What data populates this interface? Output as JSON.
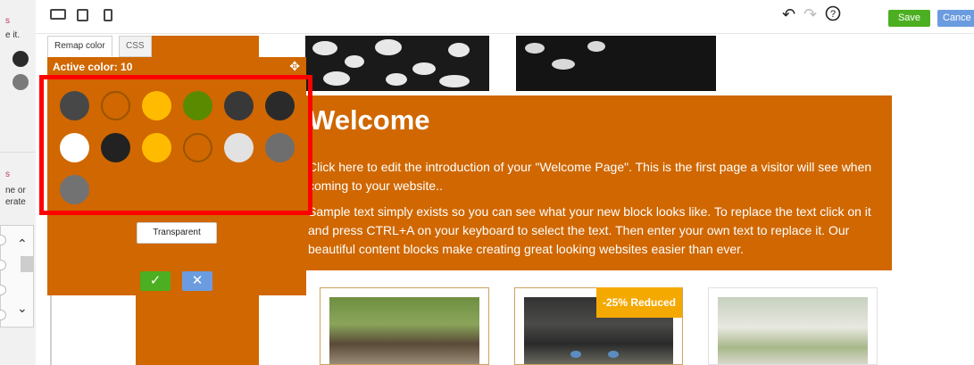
{
  "left_panel": {
    "top_text_1": "s",
    "top_text_2": "e it.",
    "dot_colors": [
      "#2b2b2b",
      "#7a7a7a"
    ],
    "mid_text_1": "s",
    "mid_text_2": "ne or",
    "mid_text_3": "erate"
  },
  "toolbar": {
    "save_label": "Save",
    "cancel_label": "Cance",
    "undo_icon": "↶",
    "redo_icon": "↷",
    "help_icon": "?"
  },
  "color_panel": {
    "tabs": [
      "Remap color",
      "CSS"
    ],
    "title": "Active color: 10",
    "swatches": [
      {
        "color": "#474747",
        "hollow": false
      },
      {
        "color": "#c86a00",
        "hollow": true
      },
      {
        "color": "#ffbb00",
        "hollow": false
      },
      {
        "color": "#5a8a00",
        "hollow": false
      },
      {
        "color": "#383838",
        "hollow": false
      },
      {
        "color": "#2a2a2a",
        "hollow": false
      },
      {
        "color": "#ffffff",
        "hollow": false
      },
      {
        "color": "#222222",
        "hollow": false
      },
      {
        "color": "#ffbb00",
        "hollow": false
      },
      {
        "color": "#c86a00",
        "hollow": true
      },
      {
        "color": "#e2e2e2",
        "hollow": false
      },
      {
        "color": "#6e6e6e",
        "hollow": false
      },
      {
        "color": "#727272",
        "hollow": false
      }
    ],
    "transparent_label": "Transparent",
    "ok_icon": "✓",
    "close_icon": "✕"
  },
  "page": {
    "welcome_title": "Welcome",
    "intro_text": "Click here to edit the introduction of your \"Welcome Page\". This is the first page a visitor will see when coming to your website..",
    "sample_text": "Sample text simply exists so you can see what your new block looks like. To replace the text click on it and press CTRL+A on your keyboard to select the text. Then enter your own text to replace it. Our beautiful content blocks make creating great looking websites easier than ever.",
    "badge": "-25% Reduced"
  },
  "colors": {
    "accent_orange": "#d06700",
    "save_green": "#4caf21",
    "cancel_blue": "#6b9ce0",
    "highlight_red": "#ff0000"
  }
}
